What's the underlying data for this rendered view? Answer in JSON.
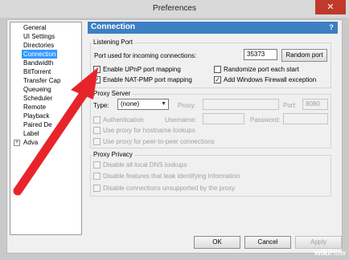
{
  "window": {
    "title": "Preferences",
    "close_symbol": "✕"
  },
  "sidebar": {
    "items": [
      {
        "label": "General"
      },
      {
        "label": "UI Settings"
      },
      {
        "label": "Directories"
      },
      {
        "label": "Connection"
      },
      {
        "label": "Bandwidth"
      },
      {
        "label": "BitTorrent"
      },
      {
        "label": "Transfer Cap"
      },
      {
        "label": "Queueing"
      },
      {
        "label": "Scheduler"
      },
      {
        "label": "Remote"
      },
      {
        "label": "Playback"
      },
      {
        "label": "Paired De"
      },
      {
        "label": "Label"
      },
      {
        "label": "Adva"
      }
    ],
    "expander_symbol": "+",
    "selected": "Connection"
  },
  "header": {
    "title": "Connection",
    "help_symbol": "?"
  },
  "listening_port": {
    "title": "Listening Port",
    "port_label": "Port used for incoming connections:",
    "port_value": "35373",
    "random_port_button": "Random port",
    "upnp_label": "Enable UPnP port mapping",
    "upnp_checked": true,
    "natpmp_label": "Enable NAT-PMP port mapping",
    "natpmp_checked": true,
    "randomize_label": "Randomize port each start",
    "randomize_checked": false,
    "firewall_label": "Add Windows Firewall exception",
    "firewall_checked": true
  },
  "proxy_server": {
    "title": "Proxy Server",
    "type_label": "Type:",
    "type_value": "(none)",
    "proxy_label": "Proxy:",
    "port_label": "Port:",
    "port_value": "8080",
    "auth_label": "Authentication",
    "username_label": "Username:",
    "password_label": "Password:",
    "hostname_lookup_label": "Use proxy for hostname lookups",
    "peer_label": "Use proxy for peer-to-peer connections"
  },
  "proxy_privacy": {
    "title": "Proxy Privacy",
    "dns_label": "Disable all local DNS lookups",
    "leak_label": "Disable features that leak identifying information",
    "unsupported_label": "Disable connections unsupported by the proxy"
  },
  "footer": {
    "ok": "OK",
    "cancel": "Cancel",
    "apply": "Apply"
  },
  "checkmark": "✓",
  "dropdown_arrow": "▼",
  "watermark": {
    "wiki": "wiki",
    "how": "How"
  },
  "colors": {
    "header_bg": "#3c7fc4",
    "selected_bg": "#3399ff",
    "arrow": "#e8242b"
  }
}
